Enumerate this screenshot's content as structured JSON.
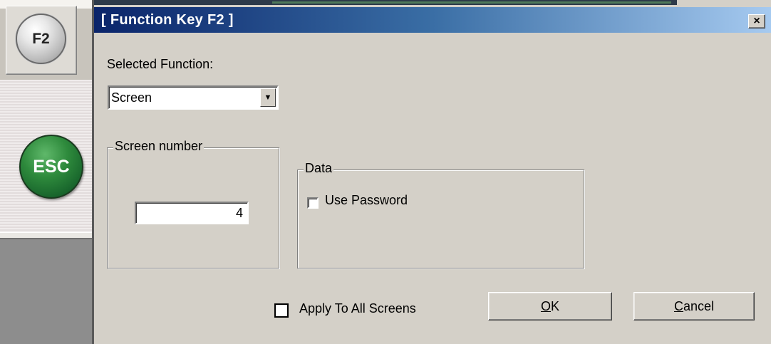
{
  "sidebar": {
    "f2_button_label": "F2",
    "esc_button_label": "ESC"
  },
  "dialog": {
    "title": "[ Function Key F2 ]",
    "close_label": "×"
  },
  "selected_function": {
    "label": "Selected Function:",
    "value": "Screen",
    "arrow": "▼"
  },
  "screen_number": {
    "group_title": "Screen number",
    "value": "4"
  },
  "data_group": {
    "title": "Data",
    "use_password_label": "Use Password",
    "use_password_checked": false
  },
  "apply_all": {
    "label": "Apply To All Screens",
    "checked": false
  },
  "buttons": {
    "ok_underline": "O",
    "ok_rest": "K",
    "cancel_underline": "C",
    "cancel_rest": "ancel"
  },
  "colors": {
    "titlebar_start": "#0a246a",
    "titlebar_end": "#a6caf0",
    "esc_green": "#2e8a3c",
    "dialog_bg": "#d4d0c8"
  },
  "icons": {
    "close": "close-icon",
    "dropdown": "chevron-down-icon"
  }
}
